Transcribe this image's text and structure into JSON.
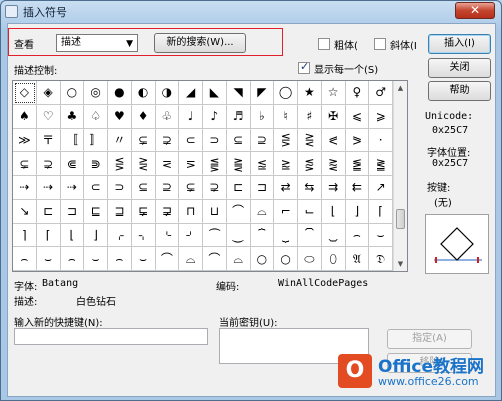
{
  "window": {
    "title": "插入符号",
    "close_glyph": "✕"
  },
  "toolbar": {
    "view_label": "查看",
    "view_select_value": "描述",
    "new_search_button": "新的搜索(W)...",
    "bold_label": "粗体(",
    "italic_label": "斜体(I",
    "insert_button": "插入(I)"
  },
  "description_control_label": "描述控制:",
  "show_each_label": "显示每一个(S)",
  "show_each_checked": true,
  "buttons": {
    "close": "关闭",
    "help": "帮助",
    "assign": "指定(A)",
    "remove": "移除"
  },
  "symbols": [
    [
      "◇",
      "◈",
      "○",
      "◎",
      "●",
      "◐",
      "◑",
      "◢",
      "◣",
      "◥",
      "◤",
      "◯",
      "★",
      "☆",
      "♀",
      "♂"
    ],
    [
      "♠",
      "♡",
      "♣",
      "♤",
      "♥",
      "♦",
      "♧",
      "♩",
      "♪",
      "♬",
      "♭",
      "♮",
      "♯",
      "✠",
      "⩽",
      "⩾"
    ],
    [
      "≫",
      "〒",
      "〚",
      "〛",
      "〃",
      "⊊",
      "⊋",
      "⊂",
      "⊃",
      "⊆",
      "⊇",
      "⋚",
      "⋛",
      "⪕",
      "⪖",
      "·"
    ],
    [
      "⊊",
      "⊋",
      "⋐",
      "⋑",
      "⋚",
      "⋛",
      "⋜",
      "⋝",
      "⪋",
      "⪌",
      "⪍",
      "⪎",
      "⪏",
      "⪐",
      "⪑",
      "⪒"
    ],
    [
      "⇢",
      "⇢",
      "⇢",
      "⊂",
      "⊃",
      "⊆",
      "⊇",
      "⊊",
      "⊋",
      "⊏",
      "⊐",
      "⇄",
      "⇆",
      "⇉",
      "⇇",
      "↗"
    ],
    [
      "↘",
      "⊏",
      "⊐",
      "⊑",
      "⊒",
      "⋤",
      "⋥",
      "⊓",
      "⊔",
      "⌒",
      "⌓",
      "⌐",
      "⌙",
      "⌊",
      "⌋",
      "⌈"
    ],
    [
      "⌉",
      "⌈",
      "⌊",
      "⌋",
      "⌌",
      "⌍",
      "⌎",
      "⌏",
      "⏜",
      "⏝",
      "⏞",
      "⏟",
      "⏠",
      "⏡",
      "⌢",
      "⌣"
    ],
    [
      "⌢",
      "⌣",
      "⌢",
      "⌣",
      "⌢",
      "⌣",
      "⌒",
      "⌓",
      "⌒",
      "⌓",
      "○",
      "○",
      "⬭",
      "⬯",
      "𝔄",
      "𝔇"
    ]
  ],
  "unicode_label": "Unicode:",
  "unicode_value": "0x25C7",
  "font_position_label": "字体位置:",
  "font_position_value": "0x25C7",
  "key_label": "按键:",
  "key_value": "(无)",
  "font_label": "字体:",
  "font_value": "Batang",
  "encoding_label": "编码:",
  "encoding_value": "WinAllCodePages",
  "description_label": "描述:",
  "description_value": "白色钻石",
  "shortcut_label": "输入新的快捷键(N):",
  "current_keys_label": "当前密钥(U):",
  "watermark": {
    "logo_text": "O",
    "name": "Office教程网",
    "url": "www.office26.com"
  }
}
